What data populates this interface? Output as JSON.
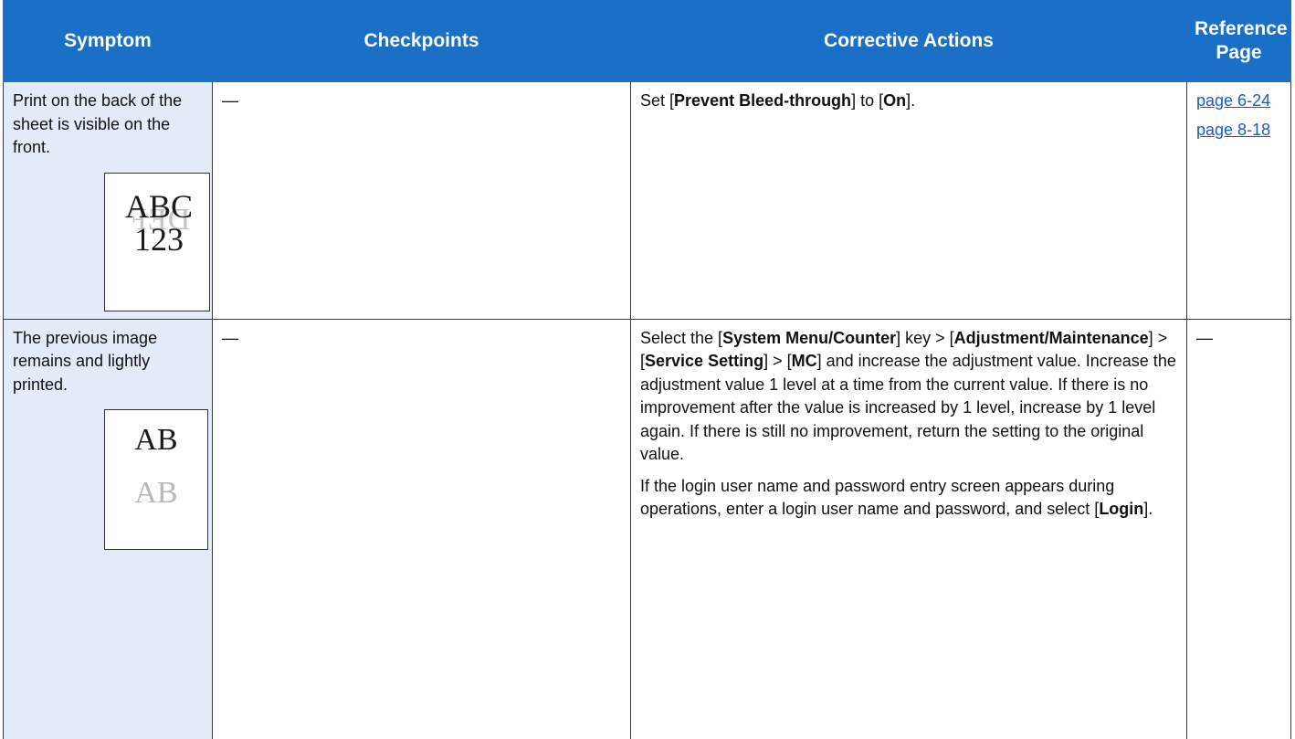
{
  "header": {
    "symptom": "Symptom",
    "checkpoints": "Checkpoints",
    "corrective_actions": "Corrective Actions",
    "reference_line1": "Reference",
    "reference_line2": "Page"
  },
  "rows": [
    {
      "symptom": "Print on the back of the sheet is visible on the front.",
      "illustration": {
        "front_line1": "ABC",
        "front_line2": "123",
        "back_text": "DEF"
      },
      "checkpoints": "—",
      "action": {
        "t1": "Set [",
        "b1": "Prevent Bleed-through",
        "t2": "] to [",
        "b2": "On",
        "t3": "]."
      },
      "references": [
        "page 6-24",
        "page 8-18"
      ]
    },
    {
      "symptom": "The previous image remains and lightly printed.",
      "illustration": {
        "line1": "AB",
        "line2": "AB"
      },
      "checkpoints": "—",
      "action": {
        "t1": "Select the [",
        "b1": "System Menu/Counter",
        "t2": "] key > [",
        "b2": "Adjustment/Maintenance",
        "t3": "] > [",
        "b3": "Service Setting",
        "t4": "] > [",
        "b4": "MC",
        "t5": "] and increase the adjustment value. Increase the adjustment value 1 level at a time from the current value. If there is no improvement after the value is increased by 1 level, increase by 1 level again. If there is still no improvement, return the setting to the original value.",
        "p2_t1": "If the login user name and password entry screen appears during operations, enter a login user name and password, and select [",
        "p2_b1": "Login",
        "p2_t2": "]."
      },
      "reference": "—"
    }
  ]
}
